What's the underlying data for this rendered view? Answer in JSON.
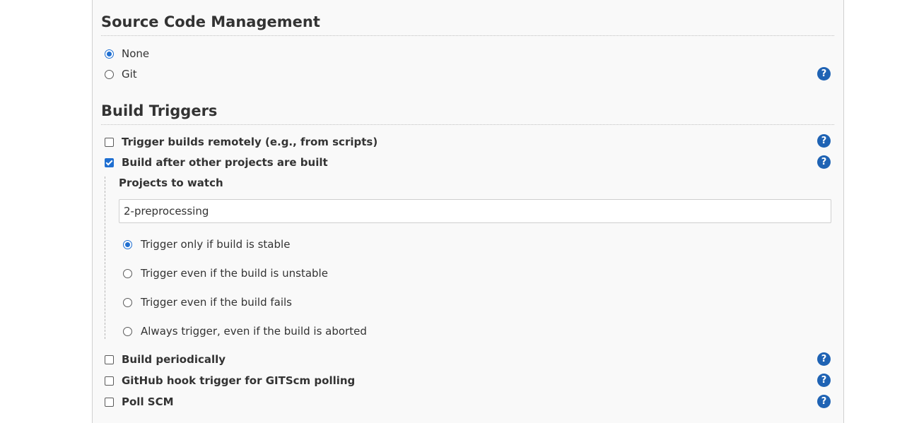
{
  "source_code_management": {
    "title": "Source Code Management",
    "options": [
      {
        "label": "None",
        "selected": true
      },
      {
        "label": "Git",
        "selected": false
      }
    ],
    "help_icon": "help-icon"
  },
  "build_triggers": {
    "title": "Build Triggers",
    "trigger_remotely": {
      "label": "Trigger builds remotely (e.g., from scripts)",
      "checked": false
    },
    "build_after_other": {
      "label": "Build after other projects are built",
      "checked": true
    },
    "projects_to_watch": {
      "label": "Projects to watch",
      "value": "2-preprocessing"
    },
    "trigger_conditions": [
      {
        "label": "Trigger only if build is stable",
        "selected": true
      },
      {
        "label": "Trigger even if the build is unstable",
        "selected": false
      },
      {
        "label": "Trigger even if the build fails",
        "selected": false
      },
      {
        "label": "Always trigger, even if the build is aborted",
        "selected": false
      }
    ],
    "build_periodically": {
      "label": "Build periodically",
      "checked": false
    },
    "github_hook": {
      "label": "GitHub hook trigger for GITScm polling",
      "checked": false
    },
    "poll_scm": {
      "label": "Poll SCM",
      "checked": false
    }
  },
  "colors": {
    "accent": "#1f6fd1",
    "help_bg": "#1f63b4",
    "panel_bg": "#f9f9f9"
  },
  "help_glyph": "?"
}
